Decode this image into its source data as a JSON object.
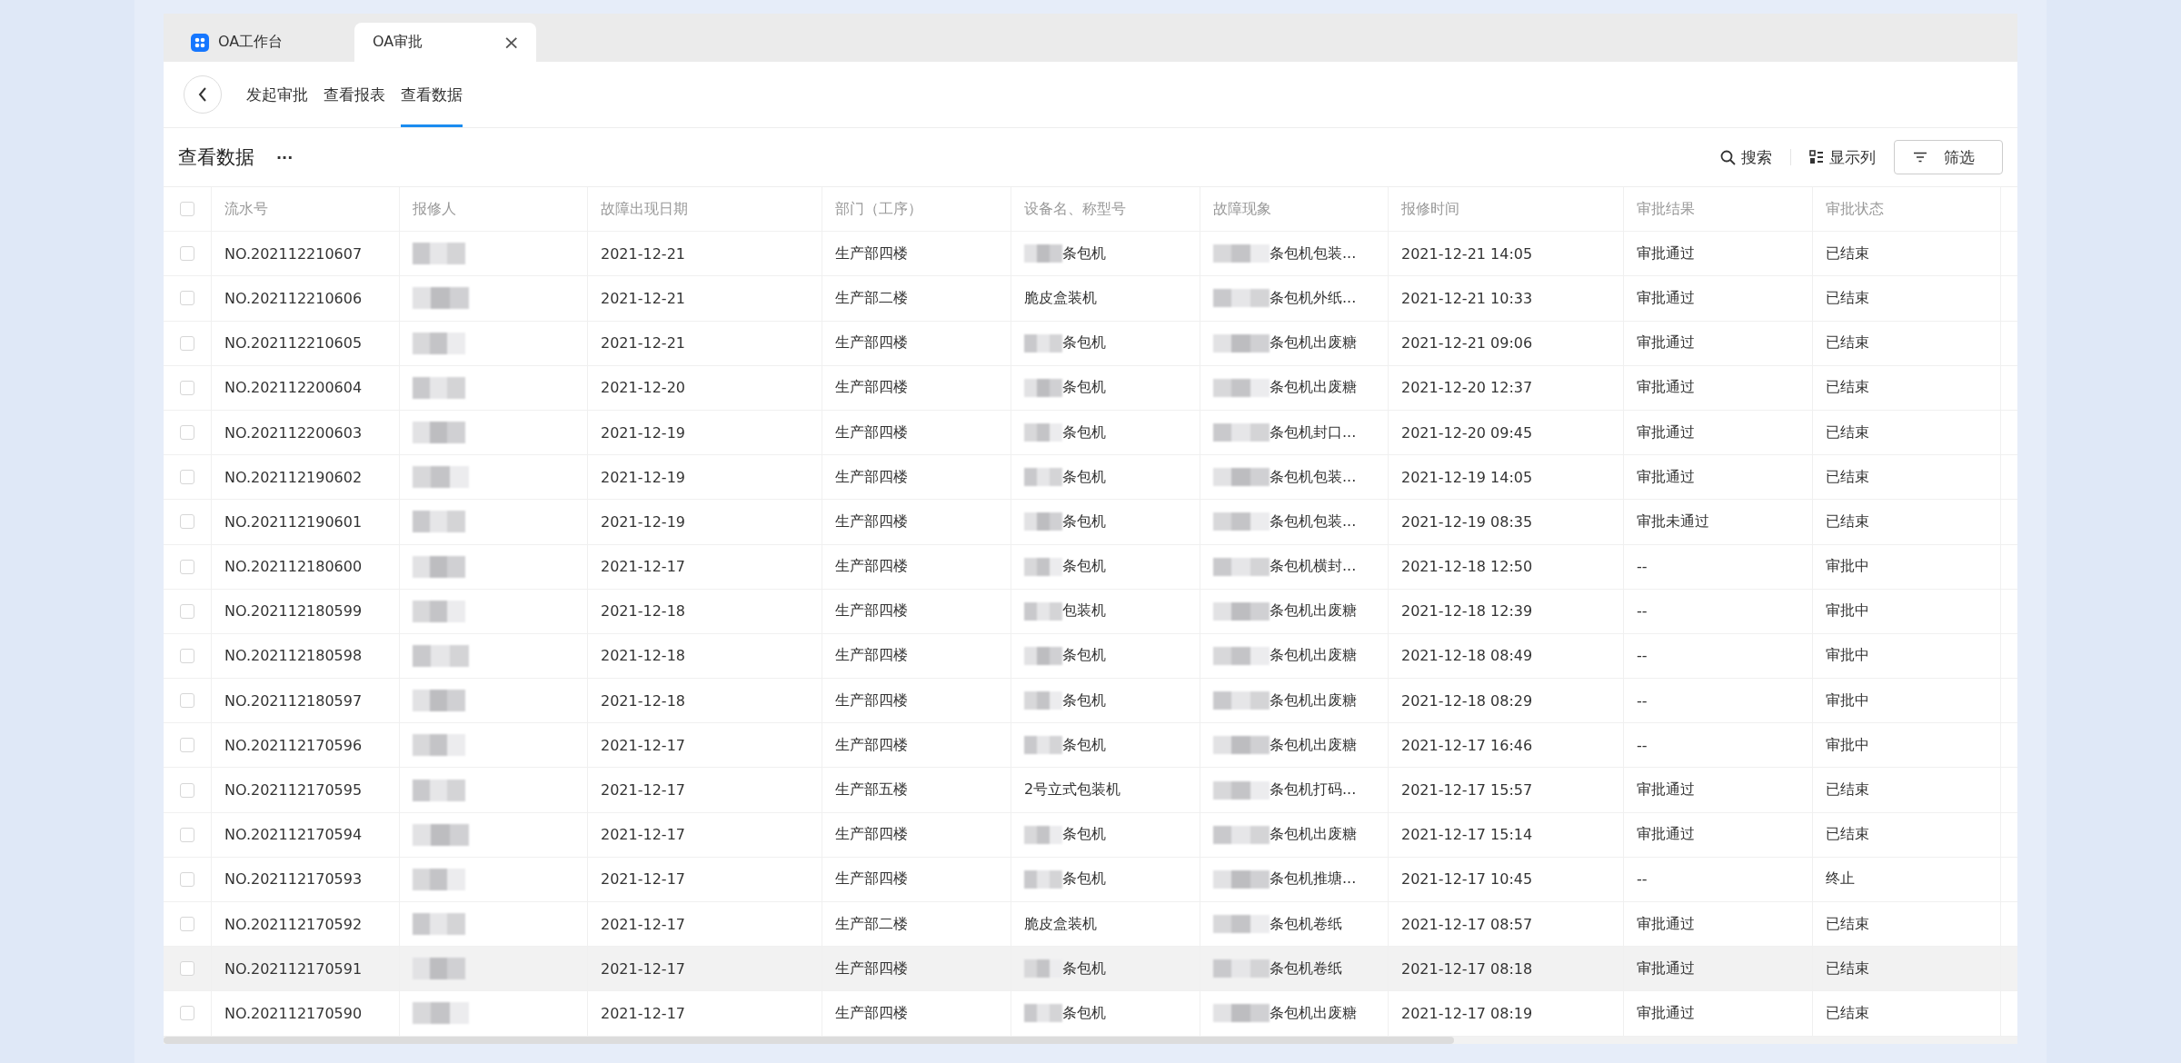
{
  "window_tabs": [
    {
      "label": "OA工作台",
      "icon": true,
      "closable": false,
      "selected": false
    },
    {
      "label": "OA审批",
      "icon": false,
      "closable": true,
      "close_glyph": "×",
      "selected": true
    }
  ],
  "nav": {
    "links": [
      {
        "label": "发起审批",
        "selected": false
      },
      {
        "label": "查看报表",
        "selected": false
      },
      {
        "label": "查看数据",
        "selected": true
      }
    ]
  },
  "toolbar": {
    "title": "查看数据",
    "more": "···",
    "search": "搜索",
    "columns": "显示列",
    "filter": "筛选"
  },
  "table": {
    "select_all_checked": false,
    "columns": [
      "流水号",
      "报修人",
      "故障出现日期",
      "部门（工序）",
      "设备名、称型号",
      "故障现象",
      "报修时间",
      "审批结果",
      "审批状态"
    ],
    "rows": [
      {
        "checked": false,
        "highlighted": false,
        "serial": "NO.202112210607",
        "date": "2021-12-21",
        "dept": "生产部四楼",
        "device": "条包机",
        "device_masked": true,
        "fault": "条包机包装...",
        "time": "2021-12-21 14:05",
        "result": "审批通过",
        "status": "已结束"
      },
      {
        "checked": false,
        "highlighted": false,
        "serial": "NO.202112210606",
        "date": "2021-12-21",
        "dept": "生产部二楼",
        "device": "脆皮盒装机",
        "device_masked": false,
        "fault": "条包机外纸...",
        "time": "2021-12-21 10:33",
        "result": "审批通过",
        "status": "已结束"
      },
      {
        "checked": false,
        "highlighted": false,
        "serial": "NO.202112210605",
        "date": "2021-12-21",
        "dept": "生产部四楼",
        "device": "条包机",
        "device_masked": true,
        "fault": "条包机出废糖",
        "time": "2021-12-21 09:06",
        "result": "审批通过",
        "status": "已结束"
      },
      {
        "checked": false,
        "highlighted": false,
        "serial": "NO.202112200604",
        "date": "2021-12-20",
        "dept": "生产部四楼",
        "device": "条包机",
        "device_masked": true,
        "fault": "条包机出废糖",
        "time": "2021-12-20 12:37",
        "result": "审批通过",
        "status": "已结束"
      },
      {
        "checked": false,
        "highlighted": false,
        "serial": "NO.202112200603",
        "date": "2021-12-19",
        "dept": "生产部四楼",
        "device": "条包机",
        "device_masked": true,
        "fault": "条包机封口...",
        "time": "2021-12-20 09:45",
        "result": "审批通过",
        "status": "已结束"
      },
      {
        "checked": false,
        "highlighted": false,
        "serial": "NO.202112190602",
        "date": "2021-12-19",
        "dept": "生产部四楼",
        "device": "条包机",
        "device_masked": true,
        "fault": "条包机包装...",
        "time": "2021-12-19 14:05",
        "result": "审批通过",
        "status": "已结束"
      },
      {
        "checked": false,
        "highlighted": false,
        "serial": "NO.202112190601",
        "date": "2021-12-19",
        "dept": "生产部四楼",
        "device": "条包机",
        "device_masked": true,
        "fault": "条包机包装...",
        "time": "2021-12-19 08:35",
        "result": "审批未通过",
        "status": "已结束"
      },
      {
        "checked": false,
        "highlighted": false,
        "serial": "NO.202112180600",
        "date": "2021-12-17",
        "dept": "生产部四楼",
        "device": "条包机",
        "device_masked": true,
        "fault": "条包机横封...",
        "time": "2021-12-18 12:50",
        "result": "--",
        "status": "审批中"
      },
      {
        "checked": false,
        "highlighted": false,
        "serial": "NO.202112180599",
        "date": "2021-12-18",
        "dept": "生产部四楼",
        "device": "包装机",
        "device_masked": true,
        "fault": "条包机出废糖",
        "time": "2021-12-18 12:39",
        "result": "--",
        "status": "审批中"
      },
      {
        "checked": false,
        "highlighted": false,
        "serial": "NO.202112180598",
        "date": "2021-12-18",
        "dept": "生产部四楼",
        "device": "条包机",
        "device_masked": true,
        "fault": "条包机出废糖",
        "time": "2021-12-18 08:49",
        "result": "--",
        "status": "审批中"
      },
      {
        "checked": false,
        "highlighted": false,
        "serial": "NO.202112180597",
        "date": "2021-12-18",
        "dept": "生产部四楼",
        "device": "条包机",
        "device_masked": true,
        "fault": "条包机出废糖",
        "time": "2021-12-18 08:29",
        "result": "--",
        "status": "审批中"
      },
      {
        "checked": false,
        "highlighted": false,
        "serial": "NO.202112170596",
        "date": "2021-12-17",
        "dept": "生产部四楼",
        "device": "条包机",
        "device_masked": true,
        "fault": "条包机出废糖",
        "time": "2021-12-17 16:46",
        "result": "--",
        "status": "审批中"
      },
      {
        "checked": false,
        "highlighted": false,
        "serial": "NO.202112170595",
        "date": "2021-12-17",
        "dept": "生产部五楼",
        "device": "2号立式包装机",
        "device_masked": false,
        "fault": "条包机打码...",
        "time": "2021-12-17 15:57",
        "result": "审批通过",
        "status": "已结束"
      },
      {
        "checked": false,
        "highlighted": false,
        "serial": "NO.202112170594",
        "date": "2021-12-17",
        "dept": "生产部四楼",
        "device": "条包机",
        "device_masked": true,
        "fault": "条包机出废糖",
        "time": "2021-12-17 15:14",
        "result": "审批通过",
        "status": "已结束"
      },
      {
        "checked": false,
        "highlighted": false,
        "serial": "NO.202112170593",
        "date": "2021-12-17",
        "dept": "生产部四楼",
        "device": "条包机",
        "device_masked": true,
        "fault": "条包机推塘...",
        "time": "2021-12-17 10:45",
        "result": "--",
        "status": "终止"
      },
      {
        "checked": false,
        "highlighted": false,
        "serial": "NO.202112170592",
        "date": "2021-12-17",
        "dept": "生产部二楼",
        "device": "脆皮盒装机",
        "device_masked": false,
        "fault": "条包机卷纸",
        "time": "2021-12-17 08:57",
        "result": "审批通过",
        "status": "已结束"
      },
      {
        "checked": false,
        "highlighted": true,
        "serial": "NO.202112170591",
        "date": "2021-12-17",
        "dept": "生产部四楼",
        "device": "条包机",
        "device_masked": true,
        "fault": "条包机卷纸",
        "time": "2021-12-17 08:18",
        "result": "审批通过",
        "status": "已结束"
      },
      {
        "checked": false,
        "highlighted": false,
        "serial": "NO.202112170590",
        "date": "2021-12-17",
        "dept": "生产部四楼",
        "device": "条包机",
        "device_masked": true,
        "fault": "条包机出废糖",
        "time": "2021-12-17 08:19",
        "result": "审批通过",
        "status": "已结束"
      }
    ]
  }
}
